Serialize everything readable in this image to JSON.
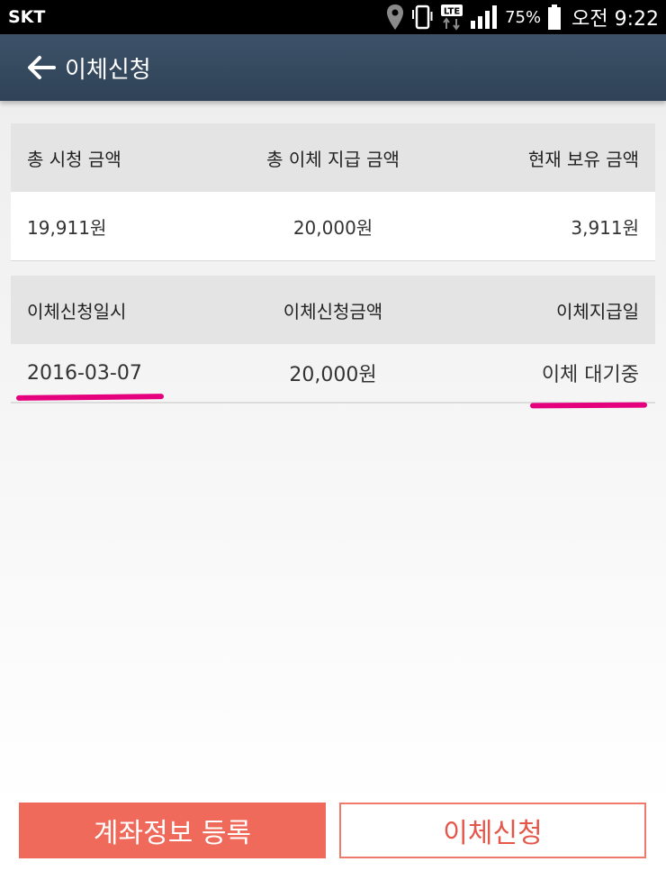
{
  "statusbar": {
    "carrier": "SKT",
    "battery": "75%",
    "time": "오전 9:22",
    "network_badge": "LTE",
    "icons": [
      "location-icon",
      "vibrate-icon",
      "lte-icon",
      "signal-icon",
      "battery-icon"
    ]
  },
  "appbar": {
    "title": "이체신청"
  },
  "summary": {
    "headers": [
      "총 시청 금액",
      "총 이체 지급 금액",
      "현재 보유 금액"
    ],
    "values": [
      "19,911원",
      "20,000원",
      "3,911원"
    ]
  },
  "history": {
    "headers": [
      "이체신청일시",
      "이체신청금액",
      "이체지급일"
    ],
    "rows": [
      [
        "2016-03-07",
        "20,000원",
        "이체 대기중"
      ]
    ]
  },
  "buttons": {
    "register": "계좌정보 등록",
    "apply": "이체신청"
  },
  "colors": {
    "appbar": "#34495e",
    "primary_button": "#ef6a5a",
    "highlight_mark": "#e5007e"
  }
}
